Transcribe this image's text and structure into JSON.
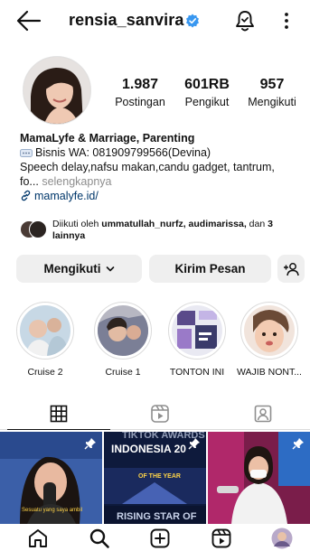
{
  "header": {
    "username": "rensia_sanvira",
    "verified": true,
    "icons": [
      "back-arrow-icon",
      "verified-badge-icon",
      "notification-bell-icon",
      "more-options-icon"
    ]
  },
  "profile": {
    "stats": [
      {
        "value": "1.987",
        "label": "Postingan"
      },
      {
        "value": "601RB",
        "label": "Pengikut"
      },
      {
        "value": "957",
        "label": "Mengikuti"
      }
    ],
    "bio": {
      "name": "MamaLyfe & Marriage, Parenting",
      "line1": "Bisnis WA: 081909799566(Devina)",
      "line2": "Speech delay,nafsu makan,candu gadget, tantrum,",
      "line3_prefix": "fo...",
      "more_label": "selengkapnya",
      "link": "mamalyfe.id/"
    },
    "followed_by": {
      "prefix": "Diikuti oleh",
      "names": "ummatullah_nurfz, audimarissa,",
      "suffix_a": "dan",
      "suffix_b": "3 lainnya"
    }
  },
  "actions": {
    "follow_label": "Mengikuti",
    "message_label": "Kirim Pesan"
  },
  "highlights": [
    {
      "label": "Cruise 2"
    },
    {
      "label": "Cruise 1"
    },
    {
      "label": "TONTON INI"
    },
    {
      "label": "WAJIB NONT..."
    }
  ],
  "tabs": [
    "grid-icon",
    "reels-icon",
    "tagged-icon"
  ],
  "grid": [
    {
      "caption": "Sesuatu yang saya ambil\nsari lebih menarik"
    },
    {
      "caption_top": "TIKTOK AWARDS",
      "caption_mid": "INDONESIA 20",
      "caption_award": "OF THE YEAR",
      "caption_bottom": "RISING STAR OF"
    },
    {
      "caption": ""
    }
  ],
  "bottom_nav": [
    "home-icon",
    "search-icon",
    "create-icon",
    "reels-nav-icon",
    "profile-avatar"
  ],
  "colors": {
    "link": "#00376b",
    "verified": "#3897f0",
    "button_bg": "#efefef",
    "muted": "#8e8e8e"
  }
}
